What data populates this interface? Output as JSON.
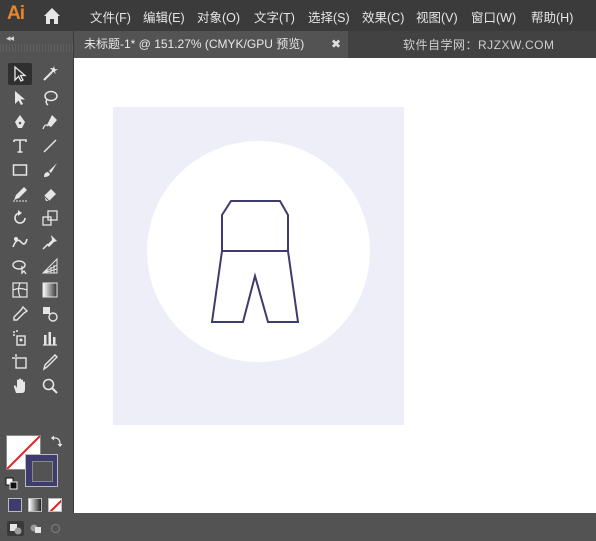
{
  "app": {
    "logo": "Ai"
  },
  "menu": [
    {
      "label": "文件(F)"
    },
    {
      "label": "编辑(E)"
    },
    {
      "label": "对象(O)"
    },
    {
      "label": "文字(T)"
    },
    {
      "label": "选择(S)"
    },
    {
      "label": "效果(C)"
    },
    {
      "label": "视图(V)"
    },
    {
      "label": "窗口(W)"
    },
    {
      "label": "帮助(H)"
    }
  ],
  "toolbar": {
    "collapse": "◂◂"
  },
  "tab": {
    "title": "未标题-1* @ 151.27% (CMYK/GPU 预览)",
    "close": "✖"
  },
  "watermark": "软件自学网：RJZXW.COM",
  "colors": {
    "pants_stroke": "#3e3c6e",
    "artboard_bg": "#eeeef9",
    "circle": "#ffffff",
    "stroke_swatch": "#3e3c6e",
    "none_slash": "#e02020"
  }
}
